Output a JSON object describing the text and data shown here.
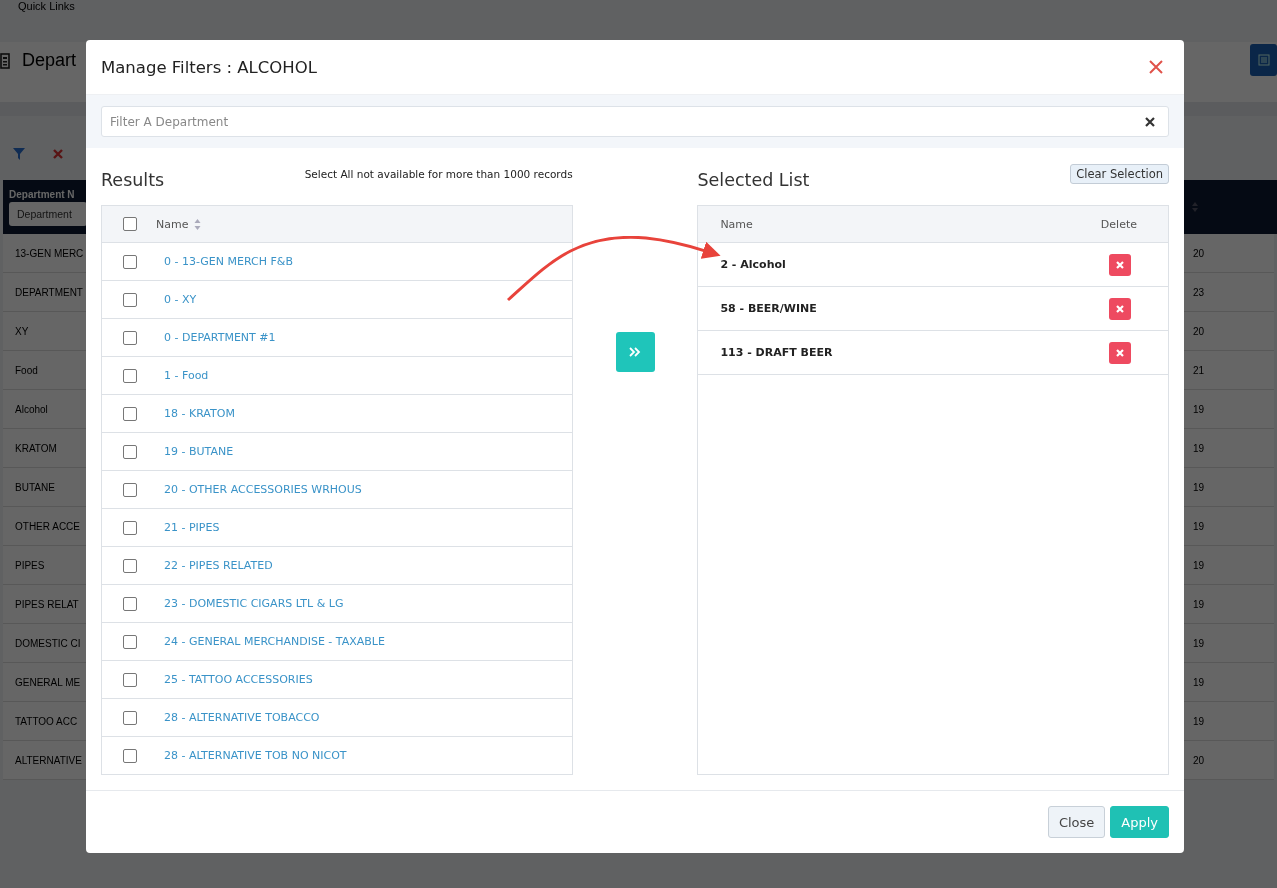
{
  "background_page": {
    "quick_links": "Quick Links",
    "page_title": "Depart",
    "table": {
      "column_header": "Department N",
      "filter_placeholder": "Department",
      "rows": [
        {
          "name": "13-GEN MERC",
          "column_2": "20"
        },
        {
          "name": "DEPARTMENT",
          "column_2": "23"
        },
        {
          "name": "XY",
          "column_2": "20"
        },
        {
          "name": "Food",
          "column_2": "21"
        },
        {
          "name": "Alcohol",
          "column_2": "19"
        },
        {
          "name": "KRATOM",
          "column_2": "19"
        },
        {
          "name": "BUTANE",
          "column_2": "19"
        },
        {
          "name": "OTHER ACCE",
          "column_2": "19"
        },
        {
          "name": "PIPES",
          "column_2": "19"
        },
        {
          "name": "PIPES RELAT",
          "column_2": "19"
        },
        {
          "name": "DOMESTIC CI",
          "column_2": "19"
        },
        {
          "name": "GENERAL ME",
          "column_2": "19"
        },
        {
          "name": "TATTOO ACC",
          "column_2": "19"
        },
        {
          "name": "ALTERNATIVE",
          "column_2": "20"
        }
      ]
    }
  },
  "modal": {
    "title": "Manage Filters : ALCOHOL",
    "filter": {
      "placeholder": "Filter A Department"
    },
    "results": {
      "title": "Results",
      "note": "Select All not available for more than 1000 records",
      "header": {
        "name": "Name",
        "checked": false
      },
      "rows": [
        {
          "label": "0 - 13-GEN MERCH F&B",
          "checked": false
        },
        {
          "label": "0 - XY",
          "checked": false
        },
        {
          "label": "0 - DEPARTMENT #1",
          "checked": false
        },
        {
          "label": "1 - Food",
          "checked": false
        },
        {
          "label": "18 - KRATOM",
          "checked": false
        },
        {
          "label": "19 - BUTANE",
          "checked": false
        },
        {
          "label": "20 - OTHER ACCESSORIES WRHOUS",
          "checked": false
        },
        {
          "label": "21 - PIPES",
          "checked": false
        },
        {
          "label": "22 - PIPES RELATED",
          "checked": false
        },
        {
          "label": "23 - DOMESTIC CIGARS LTL & LG",
          "checked": false
        },
        {
          "label": "24 - GENERAL MERCHANDISE - TAXABLE",
          "checked": false
        },
        {
          "label": "25 - TATTOO ACCESSORIES",
          "checked": false
        },
        {
          "label": "28 - ALTERNATIVE TOBACCO",
          "checked": false
        },
        {
          "label": "28 - ALTERNATIVE TOB NO NICOT",
          "checked": false
        }
      ]
    },
    "selected": {
      "title": "Selected List",
      "clear_button": "Clear Selection",
      "columns": [
        "Name",
        "Delete"
      ],
      "rows": [
        {
          "label": "2 - Alcohol"
        },
        {
          "label": "58 - BEER/WINE"
        },
        {
          "label": "113 - DRAFT BEER"
        }
      ]
    },
    "buttons": [
      {
        "label": "Close",
        "kind": "secondary"
      },
      {
        "label": "Apply",
        "kind": "primary"
      }
    ]
  }
}
